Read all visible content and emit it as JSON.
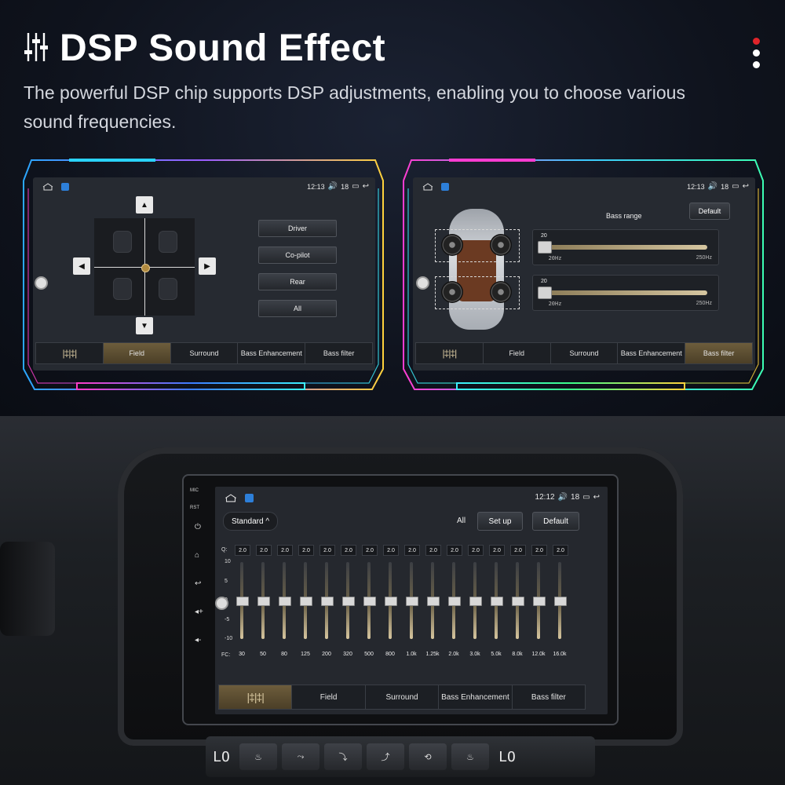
{
  "header": {
    "icon": "sliders-icon",
    "title": "DSP Sound Effect",
    "subtitle": "The powerful DSP chip supports  DSP adjustments, enabling you to choose various sound frequencies."
  },
  "colors": {
    "accent": "#c2a56b",
    "active_tab": "#5e5033",
    "page_dot_active": "#e0242a"
  },
  "screen_field": {
    "time": "12:13",
    "volume": "18",
    "positions": [
      "Driver",
      "Co-pilot",
      "Rear",
      "All"
    ],
    "arrows": {
      "up": "▲",
      "down": "▼",
      "left": "◀",
      "right": "▶"
    },
    "tabs": [
      "Field",
      "Surround",
      "Bass Enhancement",
      "Bass filter"
    ],
    "active_tab": "Field"
  },
  "screen_bass": {
    "time": "12:13",
    "volume": "18",
    "label": "Bass range",
    "default_label": "Default",
    "sliders": [
      {
        "value": "20",
        "min_label": "20Hz",
        "max_label": "250Hz"
      },
      {
        "value": "20",
        "min_label": "20Hz",
        "max_label": "250Hz"
      }
    ],
    "tabs": [
      "Field",
      "Surround",
      "Bass Enhancement",
      "Bass filter"
    ],
    "active_tab": "Bass filter"
  },
  "screen_eq": {
    "time": "12:12",
    "volume": "18",
    "side_labels": {
      "mic": "MIC",
      "rst": "RST"
    },
    "preset": "Standard ^",
    "all_label": "All",
    "setup_label": "Set up",
    "default_label": "Default",
    "q_label": "Q:",
    "fc_label": "FC:",
    "y_ticks": [
      "10",
      "5",
      "0",
      "-5",
      "-10"
    ],
    "q_values": [
      "2.0",
      "2.0",
      "2.0",
      "2.0",
      "2.0",
      "2.0",
      "2.0",
      "2.0",
      "2.0",
      "2.0",
      "2.0",
      "2.0",
      "2.0",
      "2.0",
      "2.0",
      "2.0"
    ],
    "gains": [
      0,
      0,
      0,
      0,
      0,
      0,
      0,
      0,
      0,
      0,
      0,
      0,
      0,
      0,
      0,
      0
    ],
    "frequencies": [
      "30",
      "50",
      "80",
      "125",
      "200",
      "320",
      "500",
      "800",
      "1.0k",
      "1.25k",
      "2.0k",
      "3.0k",
      "5.0k",
      "8.0k",
      "12.0k",
      "16.0k"
    ],
    "tabs": [
      "Field",
      "Surround",
      "Bass Enhancement",
      "Bass filter"
    ],
    "active_tab": "eq"
  },
  "climate": {
    "left_temp": "LO",
    "right_temp": "LO"
  }
}
